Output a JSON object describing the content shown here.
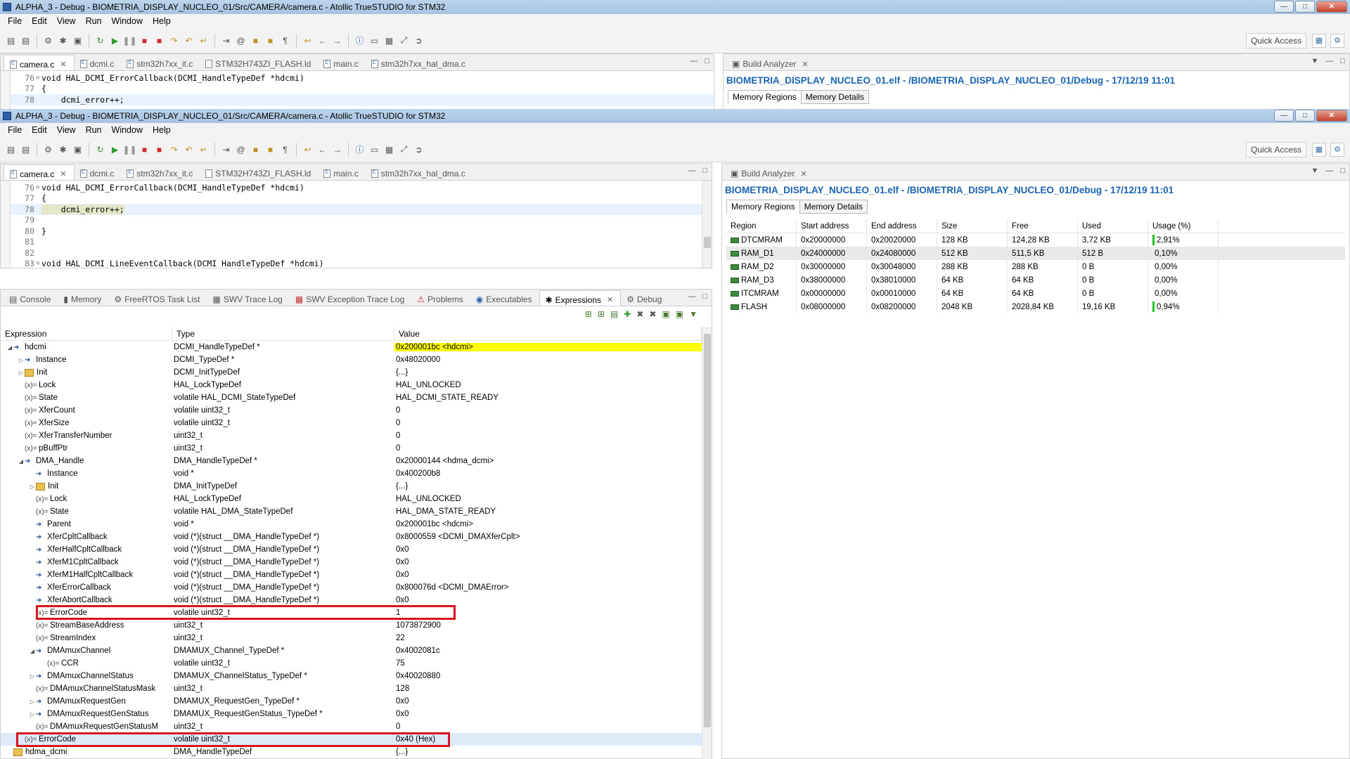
{
  "back_window": {
    "title": "ALPHA_3 - Debug - BIOMETRIA_DISPLAY_NUCLEO_01/Src/CAMERA/camera.c - Atollic TrueSTUDIO for STM32",
    "menu": [
      "File",
      "Edit",
      "View",
      "Run",
      "Window",
      "Help"
    ],
    "quick_access": "Quick Access",
    "editor_tabs": [
      "camera.c",
      "dcmi.c",
      "stm32h7xx_it.c",
      "STM32H743ZI_FLASH.ld",
      "main.c",
      "stm32h7xx_hal_dma.c"
    ],
    "code": [
      {
        "num": "76",
        "text": "void HAL_DCMI_ErrorCallback(DCMI_HandleTypeDef *hdcmi)"
      },
      {
        "num": "77",
        "text": "{"
      },
      {
        "num": "78",
        "text": "    dcmi_error++;"
      }
    ],
    "ba_tab": "Build Analyzer",
    "ba_title": "BIOMETRIA_DISPLAY_NUCLEO_01.elf - /BIOMETRIA_DISPLAY_NUCLEO_01/Debug - 17/12/19 11:01",
    "ba_subtabs": [
      "Memory Regions",
      "Memory Details"
    ]
  },
  "front_window": {
    "title": "ALPHA_3 - Debug - BIOMETRIA_DISPLAY_NUCLEO_01/Src/CAMERA/camera.c - Atollic TrueSTUDIO for STM32",
    "menu": [
      "File",
      "Edit",
      "View",
      "Run",
      "Window",
      "Help"
    ],
    "quick_access": "Quick Access",
    "editor_tabs": [
      "camera.c",
      "dcmi.c",
      "stm32h7xx_it.c",
      "STM32H743ZI_FLASH.ld",
      "main.c",
      "stm32h7xx_hal_dma.c"
    ],
    "code": [
      {
        "num": "76",
        "text": "void HAL_DCMI_ErrorCallback(DCMI_HandleTypeDef *hdcmi)"
      },
      {
        "num": "77",
        "text": "{"
      },
      {
        "num": "78",
        "text": "    dcmi_error++;"
      },
      {
        "num": "79",
        "text": ""
      },
      {
        "num": "80",
        "text": "}"
      },
      {
        "num": "81",
        "text": ""
      },
      {
        "num": "82",
        "text": ""
      },
      {
        "num": "83",
        "text": "void HAL_DCMI_LineEventCallback(DCMI_HandleTypeDef *hdcmi)"
      },
      {
        "num": "84",
        "text": "{"
      }
    ],
    "bottom_tabs": [
      "Console",
      "Memory",
      "FreeRTOS Task List",
      "SWV Trace Log",
      "SWV Exception Trace Log",
      "Problems",
      "Executables",
      "Expressions",
      "Debug"
    ],
    "expr_headers": [
      "Expression",
      "Type",
      "Value"
    ],
    "expressions": [
      {
        "name": "hdcmi",
        "type": "DCMI_HandleTypeDef *",
        "value": "0x200001bc <hdcmi>"
      },
      {
        "name": "Instance",
        "type": "DCMI_TypeDef *",
        "value": "0x48020000"
      },
      {
        "name": "Init",
        "type": "DCMI_InitTypeDef",
        "value": "{...}"
      },
      {
        "name": "Lock",
        "type": "HAL_LockTypeDef",
        "value": "HAL_UNLOCKED"
      },
      {
        "name": "State",
        "type": "volatile HAL_DCMI_StateTypeDef",
        "value": "HAL_DCMI_STATE_READY"
      },
      {
        "name": "XferCount",
        "type": "volatile uint32_t",
        "value": "0"
      },
      {
        "name": "XferSize",
        "type": "volatile uint32_t",
        "value": "0"
      },
      {
        "name": "XferTransferNumber",
        "type": "uint32_t",
        "value": "0"
      },
      {
        "name": "pBuffPtr",
        "type": "uint32_t",
        "value": "0"
      },
      {
        "name": "DMA_Handle",
        "type": "DMA_HandleTypeDef *",
        "value": "0x20000144 <hdma_dcmi>"
      },
      {
        "name": "Instance",
        "type": "void *",
        "value": "0x400200b8"
      },
      {
        "name": "Init",
        "type": "DMA_InitTypeDef",
        "value": "{...}"
      },
      {
        "name": "Lock",
        "type": "HAL_LockTypeDef",
        "value": "HAL_UNLOCKED"
      },
      {
        "name": "State",
        "type": "volatile HAL_DMA_StateTypeDef",
        "value": "HAL_DMA_STATE_READY"
      },
      {
        "name": "Parent",
        "type": "void *",
        "value": "0x200001bc <hdcmi>"
      },
      {
        "name": "XferCpltCallback",
        "type": "void (*)(struct __DMA_HandleTypeDef *)",
        "value": "0x8000559 <DCMI_DMAXferCplt>"
      },
      {
        "name": "XferHalfCpltCallback",
        "type": "void (*)(struct __DMA_HandleTypeDef *)",
        "value": "0x0"
      },
      {
        "name": "XferM1CpltCallback",
        "type": "void (*)(struct __DMA_HandleTypeDef *)",
        "value": "0x0"
      },
      {
        "name": "XferM1HalfCpltCallback",
        "type": "void (*)(struct __DMA_HandleTypeDef *)",
        "value": "0x0"
      },
      {
        "name": "XferErrorCallback",
        "type": "void (*)(struct __DMA_HandleTypeDef *)",
        "value": "0x800076d <DCMI_DMAError>"
      },
      {
        "name": "XferAbortCallback",
        "type": "void (*)(struct __DMA_HandleTypeDef *)",
        "value": "0x0"
      },
      {
        "name": "ErrorCode",
        "type": "volatile uint32_t",
        "value": "1"
      },
      {
        "name": "StreamBaseAddress",
        "type": "uint32_t",
        "value": "1073872900"
      },
      {
        "name": "StreamIndex",
        "type": "uint32_t",
        "value": "22"
      },
      {
        "name": "DMAmuxChannel",
        "type": "DMAMUX_Channel_TypeDef *",
        "value": "0x4002081c"
      },
      {
        "name": "CCR",
        "type": "volatile uint32_t",
        "value": "75"
      },
      {
        "name": "DMAmuxChannelStatus",
        "type": "DMAMUX_ChannelStatus_TypeDef *",
        "value": "0x40020880"
      },
      {
        "name": "DMAmuxChannelStatusMask",
        "type": "uint32_t",
        "value": "128"
      },
      {
        "name": "DMAmuxRequestGen",
        "type": "DMAMUX_RequestGen_TypeDef *",
        "value": "0x0"
      },
      {
        "name": "DMAmuxRequestGenStatus",
        "type": "DMAMUX_RequestGenStatus_TypeDef *",
        "value": "0x0"
      },
      {
        "name": "DMAmuxRequestGenStatusM",
        "type": "uint32_t",
        "value": "0"
      },
      {
        "name": "ErrorCode",
        "type": "volatile uint32_t",
        "value": "0x40 (Hex)"
      },
      {
        "name": "hdma_dcmi",
        "type": "DMA_HandleTypeDef",
        "value": "{...}"
      }
    ],
    "ba_tab": "Build Analyzer",
    "ba_title": "BIOMETRIA_DISPLAY_NUCLEO_01.elf - /BIOMETRIA_DISPLAY_NUCLEO_01/Debug - 17/12/19 11:01",
    "ba_subtabs": [
      "Memory Regions",
      "Memory Details"
    ],
    "mem_headers": [
      "Region",
      "Start address",
      "End address",
      "Size",
      "Free",
      "Used",
      "Usage (%)"
    ],
    "mem_regions": [
      {
        "region": "DTCMRAM",
        "start": "0x20000000",
        "end": "0x20020000",
        "size": "128 KB",
        "free": "124,28 KB",
        "used": "3,72 KB",
        "usage": "2,91%",
        "usage_fraction": 0.0291
      },
      {
        "region": "RAM_D1",
        "start": "0x24000000",
        "end": "0x24080000",
        "size": "512 KB",
        "free": "511,5 KB",
        "used": "512 B",
        "usage": "0,10%",
        "usage_fraction": 0.001
      },
      {
        "region": "RAM_D2",
        "start": "0x30000000",
        "end": "0x30048000",
        "size": "288 KB",
        "free": "288 KB",
        "used": "0 B",
        "usage": "0,00%",
        "usage_fraction": 0
      },
      {
        "region": "RAM_D3",
        "start": "0x38000000",
        "end": "0x38010000",
        "size": "64 KB",
        "free": "64 KB",
        "used": "0 B",
        "usage": "0,00%",
        "usage_fraction": 0
      },
      {
        "region": "ITCMRAM",
        "start": "0x00000000",
        "end": "0x00010000",
        "size": "64 KB",
        "free": "64 KB",
        "used": "0 B",
        "usage": "0,00%",
        "usage_fraction": 0
      },
      {
        "region": "FLASH",
        "start": "0x08000000",
        "end": "0x08200000",
        "size": "2048 KB",
        "free": "2028,84 KB",
        "used": "19,16 KB",
        "usage": "0,94%",
        "usage_fraction": 0.0094
      }
    ]
  }
}
